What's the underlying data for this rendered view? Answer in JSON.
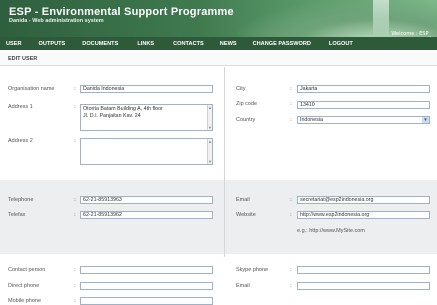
{
  "header": {
    "title": "ESP - Environmental Support Programme",
    "subtitle": "Danida - Web administration system",
    "welcome": "Welcome : ESP_"
  },
  "nav": {
    "items": [
      {
        "label": "USER"
      },
      {
        "label": "OUTPUTS"
      },
      {
        "label": "DOCUMENTS"
      },
      {
        "label": "LINKS"
      },
      {
        "label": "CONTACTS"
      },
      {
        "label": "NEWS"
      },
      {
        "label": "CHANGE PASSWORD"
      },
      {
        "label": "LOGOUT"
      }
    ]
  },
  "page": {
    "title": "EDIT USER"
  },
  "org": {
    "name_label": "Organisation name",
    "name_value": "Danida Indonesia",
    "address1_label": "Address 1",
    "address1_line1": "Otorita Batam Building A, 4th floor",
    "address1_line2": "Jl. D.I. Panjaitan Kav. 24",
    "address2_label": "Address 2",
    "address2_value": "",
    "city_label": "City",
    "city_value": "Jakarta",
    "zip_label": "Zip code",
    "zip_value": "13410",
    "country_label": "Country",
    "country_value": "Indonesia"
  },
  "contact": {
    "telephone_label": "Telephone",
    "telephone_value": "62-21-85913963",
    "telefax_label": "Telefax",
    "telefax_value": "62-21-85913962",
    "email_label": "Email",
    "email_value": "secretariat@esp2indonesia.org",
    "website_label": "Website",
    "website_value": "http://www.esp2indonesia.org",
    "website_hint": "e.g.: http://www.MySite.com"
  },
  "person": {
    "contact_person_label": "Contact person",
    "direct_phone_label": "Direct phone",
    "mobile_phone_label": "Mobile phone",
    "skype_label": "Skype phone",
    "email_label": "Email"
  },
  "colon": ":",
  "colors": {
    "nav_bg": "#2f5a3a",
    "field_border": "#9fb3c8",
    "grey_panel": "#eceef0"
  }
}
